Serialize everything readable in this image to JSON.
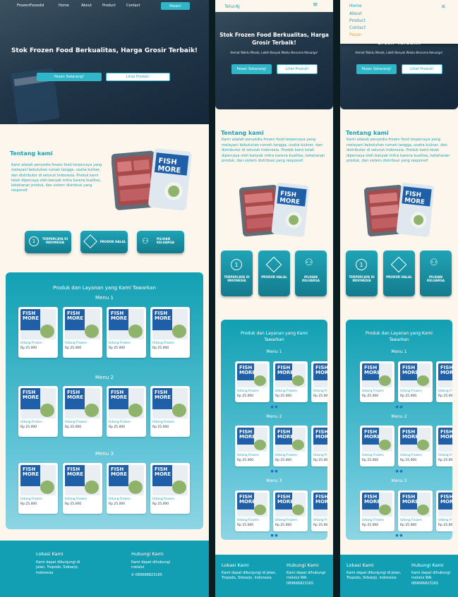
{
  "desktop": {
    "brand": "FrozenFooodd",
    "nav": [
      "Home",
      "About",
      "Product",
      "Contact"
    ],
    "cta": "Pesan!",
    "hero_title": "Stok Frozen Food Berkualitas, Harga Grosir Terbaik!",
    "btn_order": "Pesan Sekarang!",
    "btn_products": "Lihat Produk!",
    "about_title": "Tentang kami",
    "about_text": "Kami adalah penyedia frozen food terpercaya yang melayani kebutuhan rumah tangga, usaha kuliner, dan distributor di seluruh Indonesia. Produk kami telah dipercaya oleh banyak mitra karena kualitas, ketahanan produk, dan sistem distribusi yang responsif.",
    "features": [
      "TERPERCAYA DI INDONESIA",
      "PRODUK HALAL",
      "PILIHAN KELUARGA"
    ],
    "products_title": "Produk dan Layanan yang Kami Tawarkan",
    "menus": [
      "Menu 1",
      "Menu 2",
      "Menu 3"
    ],
    "item_name": "Udang Frozen",
    "item_price": "Rp 25.000",
    "loc_title": "Lokasi Kami",
    "loc_text": "Kami dapat dikunjungi di Jalan, Tropodo, Sidoarjo, Indonesia",
    "contact_title": "Hubungi Kami",
    "contact_text": "Kami dapat dihubungi melalui",
    "phone": "089666823165"
  },
  "mobile": {
    "brand": "TelurAJ",
    "hero_title": "Stok Frozen Food Berkualitas, Harga Grosir Terbaik!",
    "hero_sub": "Hemat Waktu Masak, Lebih Banyak Waktu Bersama Keluarga!",
    "btn_order": "Pesan Sekarang!",
    "btn_products": "Lihat Produk!",
    "about_title": "Tentang kami",
    "about_text": "Kami adalah penyedia frozen food terpercaya yang melayani kebutuhan rumah tangga, usaha kuliner, dan distributor di seluruh Indonesia. Produk kami telah dipercaya oleh banyak mitra karena kualitas, ketahanan produk, dan sistem distribusi yang responsif.",
    "features": [
      "TERPERCAYA DI INDONESIA",
      "PRODUK HALAL",
      "PILIHAN KELUARGA"
    ],
    "products_title": "Produk dan Layanan yang Kami Tawarkan",
    "menus": [
      "Menu 1",
      "Menu 2",
      "Menu 3"
    ],
    "item_name": "Udang Frozen",
    "item_price": "Rp 25.000",
    "loc_title": "Lokasi Kami",
    "loc_text": "Kami dapat dikunjungi di Jalan, Tropodo, Sidoarjo, Indonesia",
    "contact_title": "Hubungi Kami",
    "contact_text": "Kami dapat dihubungi melalui WA: 089666823165",
    "dots": "● ●"
  },
  "dropdown": {
    "items": [
      "Home",
      "About",
      "Product",
      "Contact",
      "Pesan"
    ],
    "close": "✕"
  },
  "colors": {
    "teal": "#1aa3b8",
    "accent": "#e8a13a",
    "cream": "#fdf6ec"
  }
}
